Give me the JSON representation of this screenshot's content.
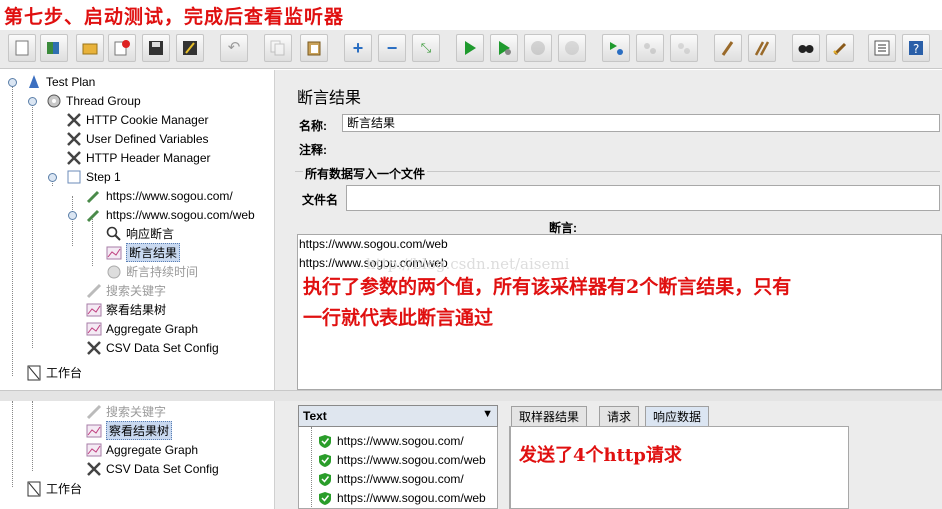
{
  "header_annotation": "第七步、启动测试，完成后查看监听器",
  "toolbar": [
    "new-icon",
    "templates-icon",
    "open-icon",
    "close-icon",
    "save-icon",
    "save-as-icon",
    "undo-icon",
    "copy-icon",
    "paste-icon",
    "expand-icon",
    "collapse-icon",
    "toggle-icon",
    "start-icon",
    "start-no-pause-icon",
    "stop-icon",
    "shutdown-icon",
    "remote-start-icon",
    "remote-stop-icon",
    "remote-shutdown-icon",
    "clear-icon",
    "clear-all-icon",
    "search-icon",
    "reset-search-icon",
    "function-helper-icon",
    "help-icon"
  ],
  "tree": {
    "test_plan": "Test Plan",
    "thread_group": "Thread Group",
    "cookie_manager": "HTTP Cookie Manager",
    "user_vars": "User Defined Variables",
    "header_manager": "HTTP Header Manager",
    "step1": "Step 1",
    "req1": "https://www.sogou.com/",
    "req2": "https://www.sogou.com/web",
    "resp_assert": "响应断言",
    "assert_results": "断言结果",
    "duration_assert": "断言持续时间",
    "search_keyword": "搜索关键字",
    "view_tree": "察看结果树",
    "aggregate": "Aggregate Graph",
    "csv": "CSV Data Set Config",
    "workbench": "工作台"
  },
  "assert_panel": {
    "title": "断言结果",
    "name_label": "名称:",
    "name_value": "断言结果",
    "comment_label": "注释:",
    "write_all_label": "所有数据写入一个文件",
    "filename_label": "文件名",
    "assertion_header": "断言:",
    "lines": [
      "https://www.sogou.com/web",
      "https://www.sogou.com/web"
    ],
    "annotation_line1": "执行了参数的两个值，所有该采样器有2个断言结果，只有",
    "annotation_line2": "一行就代表此断言通过",
    "watermark": "http://blog.csdn.net/aisemi"
  },
  "tree2": {
    "search_keyword": "搜索关键字",
    "view_tree": "察看结果树",
    "aggregate": "Aggregate Graph",
    "csv": "CSV Data Set Config",
    "workbench": "工作台"
  },
  "results": {
    "renderer": "Text",
    "items": [
      "https://www.sogou.com/",
      "https://www.sogou.com/web",
      "https://www.sogou.com/",
      "https://www.sogou.com/web"
    ],
    "tabs": [
      "取样器结果",
      "请求",
      "响应数据"
    ],
    "annotation": "发送了4个http请求"
  },
  "colors": {
    "annotation_red": "#e01010",
    "success_green": "#2a9d2a",
    "selection": "#c9d9f0"
  }
}
